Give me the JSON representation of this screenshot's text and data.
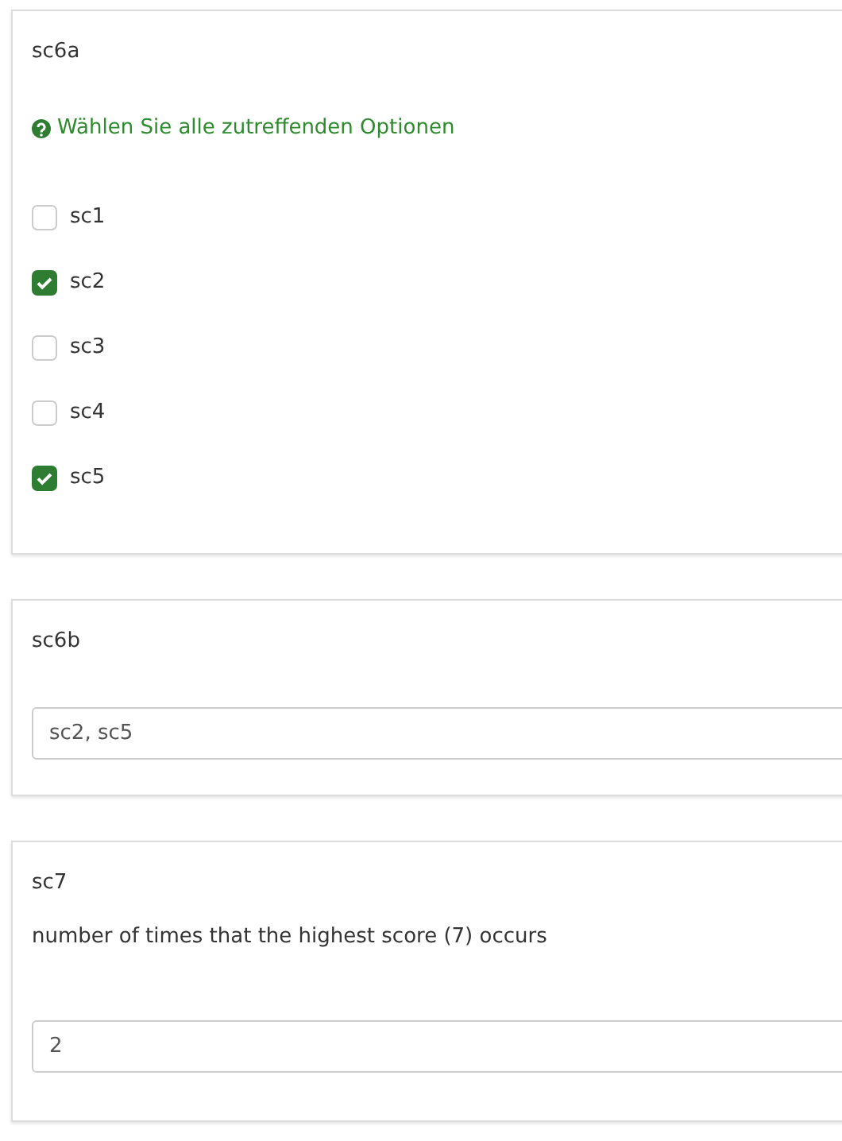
{
  "questions": [
    {
      "kind": "checkboxes",
      "title": "sc6a",
      "hint": "Wählen Sie alle zutreffenden Optionen",
      "options": [
        {
          "label": "sc1",
          "checked": false
        },
        {
          "label": "sc2",
          "checked": true
        },
        {
          "label": "sc3",
          "checked": false
        },
        {
          "label": "sc4",
          "checked": false
        },
        {
          "label": "sc5",
          "checked": true
        }
      ]
    },
    {
      "kind": "text",
      "title": "sc6b",
      "value": "sc2, sc5"
    },
    {
      "kind": "text",
      "title": "sc7",
      "description": "number of times that the highest score (7) occurs",
      "value": "2"
    }
  ]
}
